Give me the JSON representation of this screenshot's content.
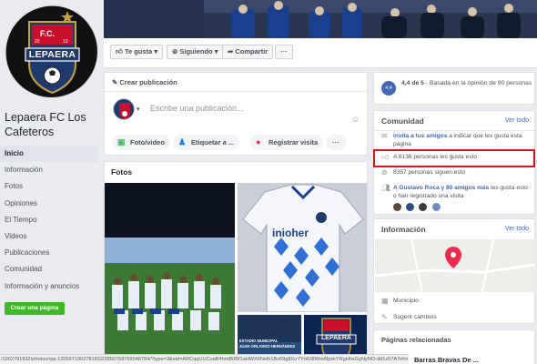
{
  "page": {
    "name": "Lepaera FC Los Cafeteros",
    "logo_text": "LEPAERA",
    "logo_fc": "F.C.",
    "logo_year_left": "20",
    "logo_year_right": "13"
  },
  "nav": {
    "items": [
      {
        "label": "Inicio",
        "active": true
      },
      {
        "label": "Información"
      },
      {
        "label": "Fotos"
      },
      {
        "label": "Opiniones"
      },
      {
        "label": "El Tiempo"
      },
      {
        "label": "Videos"
      },
      {
        "label": "Publicaciones"
      },
      {
        "label": "Comunidad"
      },
      {
        "label": "Información y anuncios"
      }
    ],
    "create_page": "Crear una página"
  },
  "actions": {
    "like": "Te gusta",
    "following": "Siguiendo",
    "share": "Compartir",
    "more": "···"
  },
  "create_post": {
    "title": "Crear publicación",
    "placeholder": "Escribe una publicación...",
    "photo_video": "Foto/video",
    "tag": "Etiquetar a ...",
    "checkin": "Registrar visita",
    "more": "···"
  },
  "photos": {
    "title": "Fotos",
    "stadium_line1": "ESTADIO MUNICIPAL",
    "stadium_line2": "JUAN ORLANDO HERNÁNDEZ",
    "jersey_sponsor": "inioher"
  },
  "rating": {
    "score": "4,4",
    "text_bold": "4,4 de 5",
    "text": "Basada en la opinión de 90 personas"
  },
  "community": {
    "title": "Comunidad",
    "see_all": "Ver todo",
    "invite_link": "Invita a tus amigos",
    "invite_text": "a indicar que les gusta esta página",
    "likes": "A 8136 personas les gusta esto",
    "follows": "8357 personas siguen esto",
    "friends_links": "A Gustavo Roca y 80 amigos más",
    "friends_text": "les gusta esto o han registrado una visita"
  },
  "info": {
    "title": "Información",
    "see_all": "Ver todo",
    "municipio": "Municipio",
    "suggest": "Sugerir cambios"
  },
  "related": {
    "title": "Páginas relacionadas",
    "item": "Barras Bravas De ..."
  },
  "statusbar": {
    "url": "/1902781832/photos/rpp.1205971902781832/2850768769048784/?type=3&eid=ARCqqUUCuaB4hmB0Bf1aHWX6Nelh1Bx69g8XoYYnfU8Wmt9pxkYRgHhxGyNyNO-dd1x57A7ehn"
  },
  "colors": {
    "fb_blue": "#4267b2",
    "green": "#42b72a",
    "highlight": "#d9141f"
  }
}
